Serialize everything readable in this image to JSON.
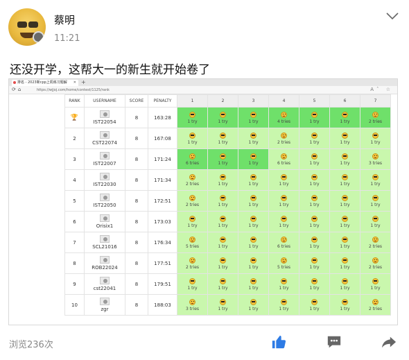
{
  "post": {
    "author": "蔡明",
    "time": "11:21",
    "text": "还没开学，这帮大一的新生就开始卷了",
    "views": "浏览236次"
  },
  "browser": {
    "tab_title": "排名 - 2023新cpp上机练习题解",
    "url": "https://wjjoj.com/home/contest/1125/rank"
  },
  "table": {
    "headers": [
      "RANK",
      "USERNAME",
      "SCORE",
      "PENALTY",
      "1",
      "2",
      "3",
      "4",
      "5",
      "6",
      "7"
    ],
    "rows": [
      {
        "rank": "🏆",
        "user": "IST22054",
        "score": "8",
        "penalty": "163:28",
        "cells": [
          [
            "cool",
            "1 try",
            1
          ],
          [
            "cool",
            "1 try",
            1
          ],
          [
            "cool",
            "1 try",
            1
          ],
          [
            "hm",
            "4 tries",
            1
          ],
          [
            "cool",
            "1 try",
            1
          ],
          [
            "cool",
            "1 try",
            1
          ],
          [
            "hm",
            "2 tries",
            1
          ]
        ]
      },
      {
        "rank": "2",
        "user": "CST22074",
        "score": "8",
        "penalty": "167:08",
        "cells": [
          [
            "cool",
            "1 try",
            0
          ],
          [
            "cool",
            "1 try",
            0
          ],
          [
            "cool",
            "1 try",
            0
          ],
          [
            "hm",
            "2 tries",
            0
          ],
          [
            "cool",
            "1 try",
            0
          ],
          [
            "cool",
            "1 try",
            0
          ],
          [
            "cool",
            "1 try",
            0
          ]
        ]
      },
      {
        "rank": "3",
        "user": "IST22007",
        "score": "8",
        "penalty": "171:24",
        "cells": [
          [
            "hm",
            "6 tries",
            1
          ],
          [
            "cool",
            "1 try",
            1
          ],
          [
            "cool",
            "1 try",
            1
          ],
          [
            "hm",
            "6 tries",
            0
          ],
          [
            "cool",
            "1 try",
            0
          ],
          [
            "cool",
            "1 try",
            0
          ],
          [
            "hm",
            "3 tries",
            0
          ]
        ]
      },
      {
        "rank": "4",
        "user": "IST22030",
        "score": "8",
        "penalty": "171:34",
        "cells": [
          [
            "hm",
            "2 tries",
            0
          ],
          [
            "cool",
            "1 try",
            0
          ],
          [
            "cool",
            "1 try",
            0
          ],
          [
            "cool",
            "1 try",
            0
          ],
          [
            "cool",
            "1 try",
            0
          ],
          [
            "cool",
            "1 try",
            0
          ],
          [
            "cool",
            "1 try",
            0
          ]
        ]
      },
      {
        "rank": "5",
        "user": "IST22050",
        "score": "8",
        "penalty": "172:51",
        "cells": [
          [
            "hm",
            "2 tries",
            0
          ],
          [
            "cool",
            "1 try",
            0
          ],
          [
            "cool",
            "1 try",
            0
          ],
          [
            "cool",
            "1 try",
            0
          ],
          [
            "cool",
            "1 try",
            0
          ],
          [
            "cool",
            "1 try",
            0
          ],
          [
            "cool",
            "1 try",
            0
          ]
        ]
      },
      {
        "rank": "6",
        "user": "Orisix1",
        "score": "8",
        "penalty": "173:03",
        "cells": [
          [
            "cool",
            "1 try",
            0
          ],
          [
            "cool",
            "1 try",
            0
          ],
          [
            "cool",
            "1 try",
            0
          ],
          [
            "cool",
            "1 try",
            0
          ],
          [
            "cool",
            "1 try",
            0
          ],
          [
            "cool",
            "1 try",
            0
          ],
          [
            "cool",
            "1 try",
            0
          ]
        ]
      },
      {
        "rank": "7",
        "user": "SCL21016",
        "score": "8",
        "penalty": "176:34",
        "cells": [
          [
            "hm",
            "5 tries",
            0
          ],
          [
            "cool",
            "1 try",
            0
          ],
          [
            "cool",
            "1 try",
            0
          ],
          [
            "hm",
            "6 tries",
            0
          ],
          [
            "cool",
            "1 try",
            0
          ],
          [
            "cool",
            "1 try",
            0
          ],
          [
            "hm",
            "2 tries",
            0
          ]
        ]
      },
      {
        "rank": "8",
        "user": "ROB22024",
        "score": "8",
        "penalty": "177:51",
        "cells": [
          [
            "hm",
            "2 tries",
            0
          ],
          [
            "cool",
            "1 try",
            0
          ],
          [
            "cool",
            "1 try",
            0
          ],
          [
            "hm",
            "5 tries",
            0
          ],
          [
            "cool",
            "1 try",
            0
          ],
          [
            "cool",
            "1 try",
            0
          ],
          [
            "hm",
            "2 tries",
            0
          ]
        ]
      },
      {
        "rank": "9",
        "user": "cst22041",
        "score": "8",
        "penalty": "179:51",
        "cells": [
          [
            "cool",
            "1 try",
            0
          ],
          [
            "cool",
            "1 try",
            0
          ],
          [
            "cool",
            "1 try",
            0
          ],
          [
            "cool",
            "1 try",
            0
          ],
          [
            "cool",
            "1 try",
            0
          ],
          [
            "cool",
            "1 try",
            0
          ],
          [
            "cool",
            "1 try",
            0
          ]
        ]
      },
      {
        "rank": "10",
        "user": "zgr",
        "score": "8",
        "penalty": "188:03",
        "cells": [
          [
            "hm",
            "3 tries",
            0
          ],
          [
            "cool",
            "1 try",
            0
          ],
          [
            "cool",
            "1 try",
            0
          ],
          [
            "cool",
            "1 try",
            0
          ],
          [
            "cool",
            "1 try",
            0
          ],
          [
            "cool",
            "1 try",
            0
          ],
          [
            "hm",
            "2 tries",
            0
          ]
        ]
      }
    ]
  },
  "colors": {
    "accepted": "#c9f7ad",
    "first_blood": "#6fe06a",
    "like_icon": "#2d7be5",
    "icon_gray": "#666666"
  },
  "icons": {
    "more": "chevron-down-icon",
    "like": "thumbs-up-icon",
    "comment": "comment-icon",
    "share": "share-icon"
  }
}
